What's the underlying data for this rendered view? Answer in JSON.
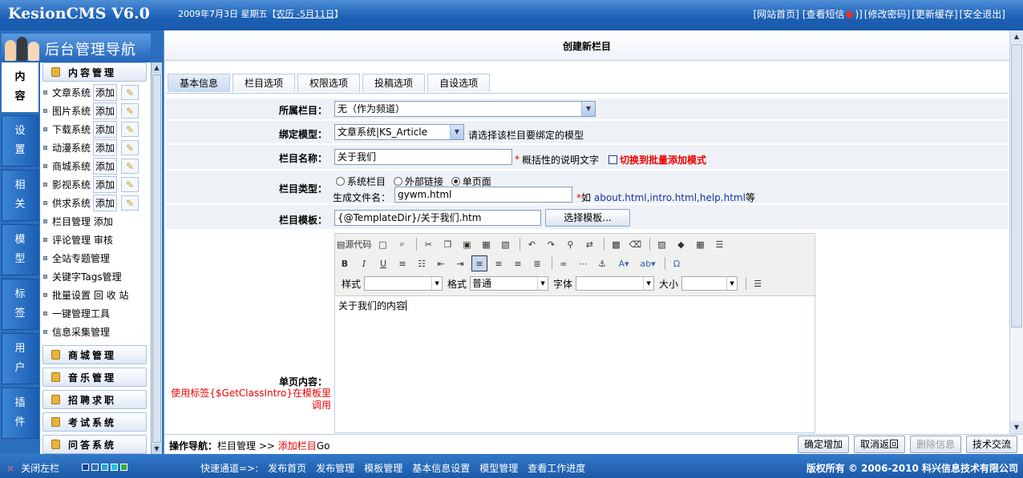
{
  "header": {
    "logo": "KesionCMS V6.0",
    "date": "2009年7月3日 星期五",
    "lunar_open": "【",
    "lunar": "农历 -5月11日",
    "lunar_close": "】",
    "links": [
      "[网站首页]",
      "[查看短信",
      ")]",
      "[修改密码]",
      "[更新缓存]",
      "[安全退出]"
    ]
  },
  "sidebar": {
    "title": "后台管理导航",
    "vtabs": [
      {
        "a": "内",
        "b": "容"
      },
      {
        "a": "设",
        "b": "置"
      },
      {
        "a": "相",
        "b": "关"
      },
      {
        "a": "模",
        "b": "型"
      },
      {
        "a": "标",
        "b": "签"
      },
      {
        "a": "用",
        "b": "户"
      },
      {
        "a": "插",
        "b": "件"
      }
    ],
    "group_main": "内容管理",
    "add_label": "添加",
    "items_with_buttons": [
      "文章系统",
      "图片系统",
      "下载系统",
      "动漫系统",
      "商城系统",
      "影视系统",
      "供求系统"
    ],
    "items": [
      "栏目管理 添加",
      "评论管理 审核",
      "全站专题管理",
      "关键字Tags管理",
      "批量设置 回 收 站",
      "一键管理工具",
      "信息采集管理"
    ],
    "groups": [
      "商城管理",
      "音乐管理",
      "招聘求职",
      "考试系统",
      "问答系统"
    ]
  },
  "main": {
    "page_title": "创建新栏目",
    "tabs": [
      "基本信息",
      "栏目选项",
      "权限选项",
      "投稿选项",
      "自设选项"
    ],
    "form": {
      "parent_label": "所属栏目：",
      "parent_value": "无（作为频道）",
      "model_label": "绑定模型：",
      "model_value": "文章系统|KS_Article",
      "model_hint": "请选择该栏目要绑定的模型",
      "name_label": "栏目名称：",
      "name_value": "关于我们",
      "name_required": "*",
      "name_hint": "概括性的说明文字",
      "batch_label": "切换到批量添加模式",
      "type_label": "栏目类型：",
      "type_options": [
        "系统栏目",
        "外部链接",
        "单页面"
      ],
      "filename_label": "生成文件名：",
      "filename_value": "gywm.html",
      "filename_star": "*",
      "filename_hint_prefix": "如",
      "filename_examples": "about.html,intro.html,help.html",
      "filename_hint_suffix": "等",
      "template_label": "栏目模板：",
      "template_value": "{@TemplateDir}/关于我们.htm",
      "template_button": "选择模板...",
      "content_label": "单页内容：",
      "content_note": "使用标签{$GetClassIntro}在模板里调用"
    },
    "editor": {
      "source_label": "源代码",
      "style_label": "样式",
      "format_label": "格式",
      "format_value": "普通",
      "font_label": "字体",
      "size_label": "大小",
      "content": "关于我们的内容"
    },
    "bottom": {
      "crumb_label": "操作导航：",
      "crumb_1": "栏目管理",
      "crumb_sep": ">>",
      "crumb_2": "添加栏目",
      "crumb_go": "Go",
      "buttons": [
        "确定增加",
        "取消返回",
        "删除信息",
        "技术交流"
      ]
    }
  },
  "footer": {
    "close_icon": "×",
    "close_label": "关闭左栏",
    "swatches": [
      "#1a3f9a",
      "#2f6db5",
      "#2aa0d8",
      "#21c0e0",
      "#39a845"
    ],
    "quick_label": "快速通道=>:",
    "quick_links": [
      "发布首页",
      "发布管理",
      "模板管理",
      "基本信息设置",
      "模型管理",
      "查看工作进度"
    ],
    "copyright": "版权所有 © 2006-2010 科兴信息技术有限公司"
  },
  "colors": {
    "brand": "#1b5fb4",
    "required": "#e00000",
    "link": "#1833a8"
  }
}
